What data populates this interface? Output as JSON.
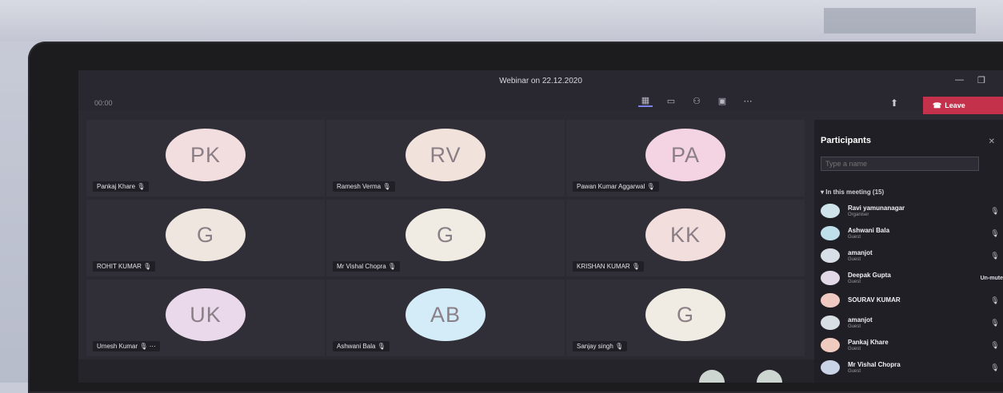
{
  "window": {
    "title": "Webinar on 22.12.2020",
    "timer": "00:00",
    "minimize": "—",
    "maximize": "❐"
  },
  "toolbar": {
    "icons": [
      "grid-view-icon",
      "chat-icon",
      "participants-icon",
      "video-icon",
      "more-icon"
    ],
    "leave_label": "Leave"
  },
  "tiles": [
    {
      "initials": "PK",
      "name": "Pankaj Khare",
      "color": "#f2dedf"
    },
    {
      "initials": "RV",
      "name": "Ramesh Verma",
      "color": "#f1e2dc"
    },
    {
      "initials": "PA",
      "name": "Pawan Kumar Aggarwal",
      "color": "#f4d4e2"
    },
    {
      "initials": "G",
      "name": "ROHIT KUMAR",
      "color": "#efe6e0"
    },
    {
      "initials": "G",
      "name": "Mr Vishal Chopra",
      "color": "#f0ebe3"
    },
    {
      "initials": "KK",
      "name": "KRISHAN KUMAR",
      "color": "#f2dedd"
    },
    {
      "initials": "UK",
      "name": "Umesh Kumar",
      "color": "#ead9ea"
    },
    {
      "initials": "AB",
      "name": "Ashwani Bala",
      "color": "#d4ecf8"
    },
    {
      "initials": "G",
      "name": "Sanjay singh",
      "color": "#f0ebe3"
    }
  ],
  "participants_panel": {
    "title": "Participants",
    "search_placeholder": "Type a name",
    "section": "In this meeting (15)",
    "people": [
      {
        "name": "Ravi yamunanagar",
        "role": "Organiser",
        "status": "",
        "color": "#cfe3ea"
      },
      {
        "name": "Ashwani Bala",
        "role": "Guest",
        "status": "",
        "color": "#bfe0ea"
      },
      {
        "name": "amanjot",
        "role": "Guest",
        "status": "",
        "color": "#d8dfe6"
      },
      {
        "name": "Deepak Gupta",
        "role": "Guest",
        "status": "Un-mute",
        "color": "#e2d8e6"
      },
      {
        "name": "SOURAV KUMAR",
        "role": "",
        "status": "",
        "color": "#f1c9c3"
      },
      {
        "name": "amanjot",
        "role": "Guest",
        "status": "",
        "color": "#d7dee4"
      },
      {
        "name": "Pankaj Khare",
        "role": "Guest",
        "status": "",
        "color": "#f0cbbf"
      },
      {
        "name": "Mr Vishal Chopra",
        "role": "Guest",
        "status": "",
        "color": "#c9d4e6"
      }
    ]
  }
}
